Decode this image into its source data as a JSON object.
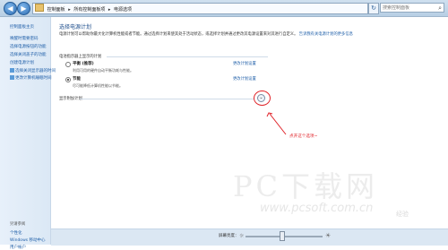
{
  "window": {
    "breadcrumb": [
      "控制面板",
      "所有控制面板项",
      "电源选项"
    ],
    "search_placeholder": "搜索控制面板"
  },
  "sidebar": {
    "items": [
      {
        "label": "控制面板主页"
      },
      {
        "label": "唤醒时需要密码"
      },
      {
        "label": "选择电源按钮的功能"
      },
      {
        "label": "选择关闭盖子的功能"
      },
      {
        "label": "创建电源计划"
      },
      {
        "label": "选择关闭显示器的时间"
      },
      {
        "label": "更改计算机睡眠时间"
      }
    ],
    "see_also": "另请参阅",
    "see_also_items": [
      {
        "label": "个性化"
      },
      {
        "label": "Windows 移动中心"
      },
      {
        "label": "用户帐户"
      }
    ]
  },
  "main": {
    "heading": "选择电源计划",
    "description": "电源计划可以帮助你最大化计算机性能或者节能。通过选择计划来使其处于活动状态，或选择计划并通过更改其电源设置来对其进行自定义。",
    "description_link": "告诉我有关电源计划的更多信息",
    "section_label": "电池指示器上显示的计划",
    "plans": [
      {
        "name": "平衡 (推荐)",
        "desc": "利用可用的硬件自动平衡功耗与性能。",
        "link": "更改计划设置",
        "selected": false
      },
      {
        "name": "节能",
        "desc": "尽可能降低计算机性能以节能。",
        "link": "更改计划设置",
        "selected": true
      }
    ],
    "hidden_plans_label": "显示附加计划",
    "expander_glyph": "⌄"
  },
  "annotation": {
    "text": "点开这个选项~"
  },
  "footer": {
    "brightness_label": "屏幕亮度：",
    "brightness_level": 0.47
  },
  "watermark": {
    "title": "PC下载网",
    "url": "www.pcsoft.com.cn",
    "logo_text": "经验"
  }
}
